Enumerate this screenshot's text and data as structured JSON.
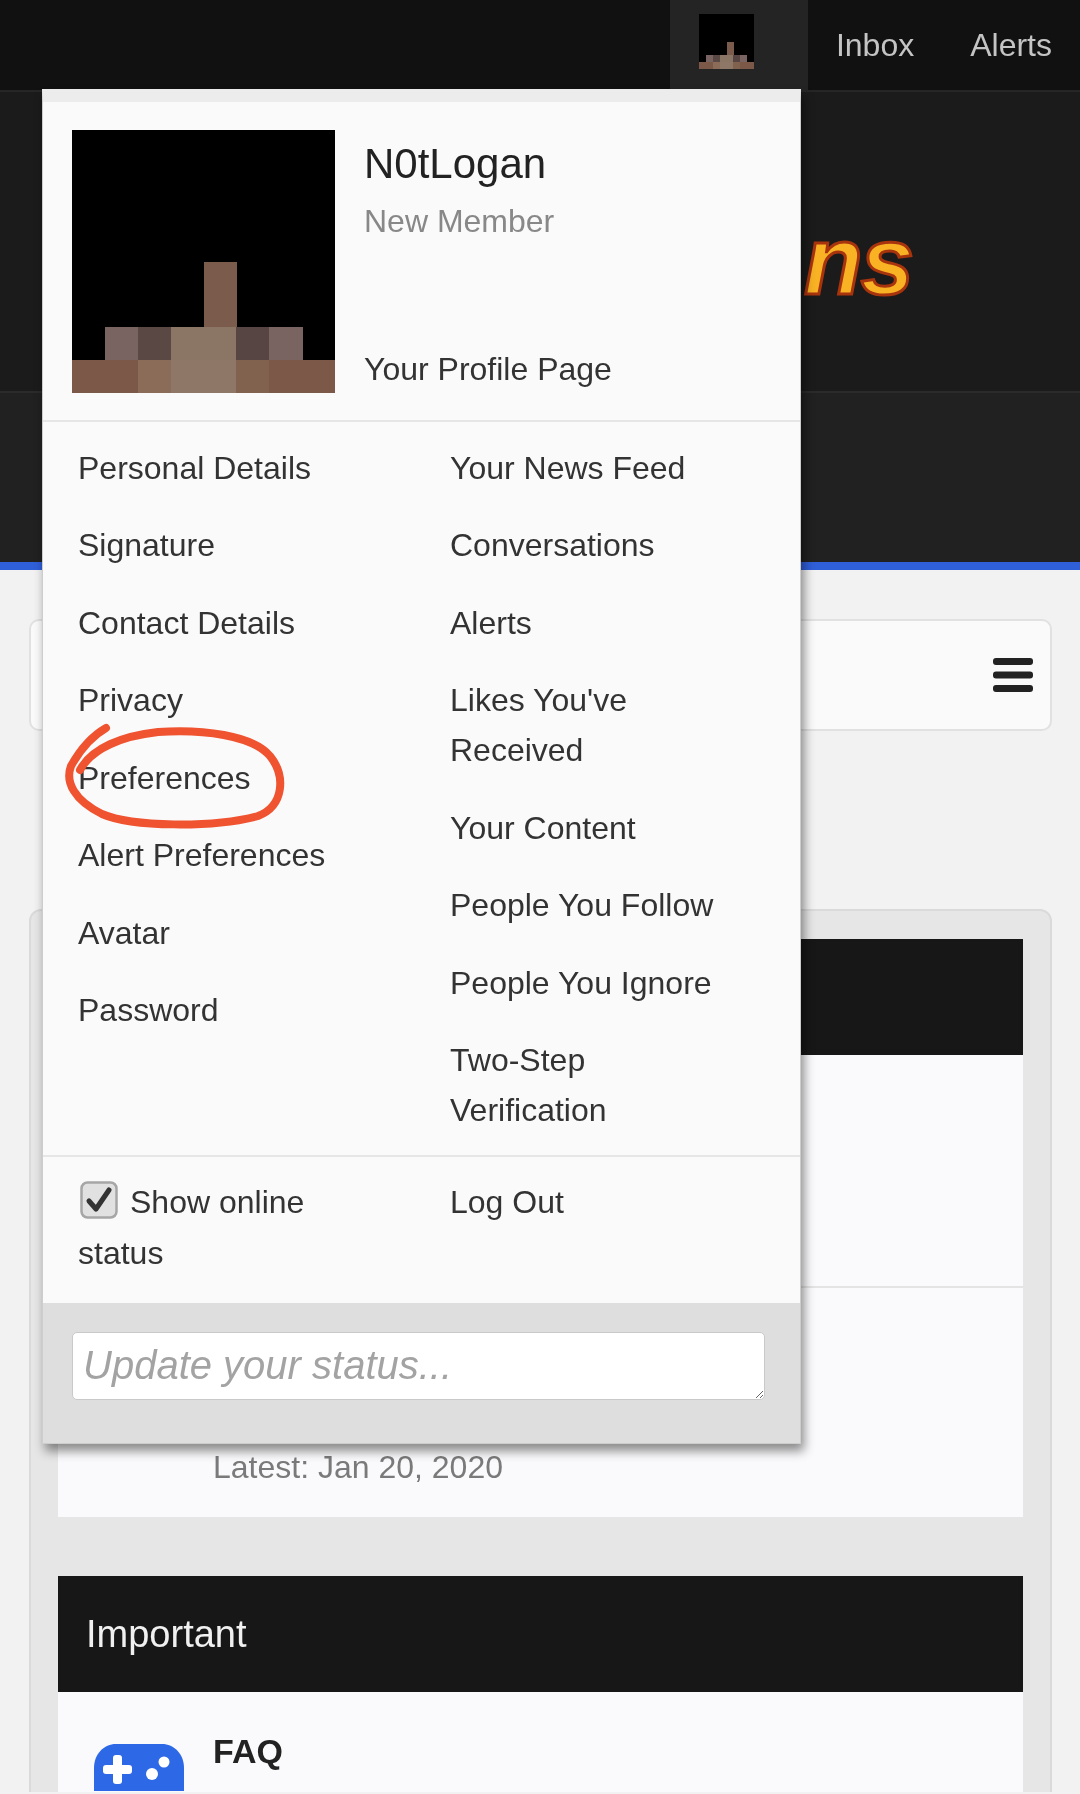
{
  "top_bar": {
    "items": [
      {
        "kind": "avatar",
        "selected": true
      },
      {
        "kind": "link",
        "label": "Inbox",
        "selected": false
      },
      {
        "kind": "link",
        "label": "Alerts",
        "selected": false
      }
    ]
  },
  "header": {
    "logo_text": "ns"
  },
  "forum": {
    "categories": [
      {
        "nodes": [
          {
            "kind": "covered"
          },
          {
            "kind": "node",
            "latest": "Latest: Jan 20, 2020"
          }
        ]
      },
      {
        "title": "Important",
        "nodes": [
          {
            "kind": "node",
            "title": "FAQ"
          }
        ]
      }
    ]
  },
  "user_menu": {
    "username": "N0tLogan",
    "user_title": "New Member",
    "profile_link": "Your Profile Page",
    "left_links": [
      {
        "label": "Personal Details",
        "circled": false
      },
      {
        "label": "Signature",
        "circled": false
      },
      {
        "label": "Contact Details",
        "circled": false
      },
      {
        "label": "Privacy",
        "circled": false
      },
      {
        "label": "Preferences",
        "circled": true
      },
      {
        "label": "Alert Preferences",
        "circled": false
      },
      {
        "label": "Avatar",
        "circled": false
      },
      {
        "label": "Password",
        "circled": false
      }
    ],
    "right_links": [
      {
        "label": "Your News Feed",
        "circled": false
      },
      {
        "label": "Conversations",
        "circled": false
      },
      {
        "label": "Alerts",
        "circled": false
      },
      {
        "label": "Likes You've Received",
        "circled": false
      },
      {
        "label": "Your Content",
        "circled": false
      },
      {
        "label": "People You Follow",
        "circled": false
      },
      {
        "label": "People You Ignore",
        "circled": false
      },
      {
        "label": "Two-Step Verification",
        "circled": false
      }
    ],
    "online_status": {
      "label": "Show online status",
      "checked": true
    },
    "logout": "Log Out",
    "status_field": {
      "placeholder": "Update your status..."
    }
  }
}
